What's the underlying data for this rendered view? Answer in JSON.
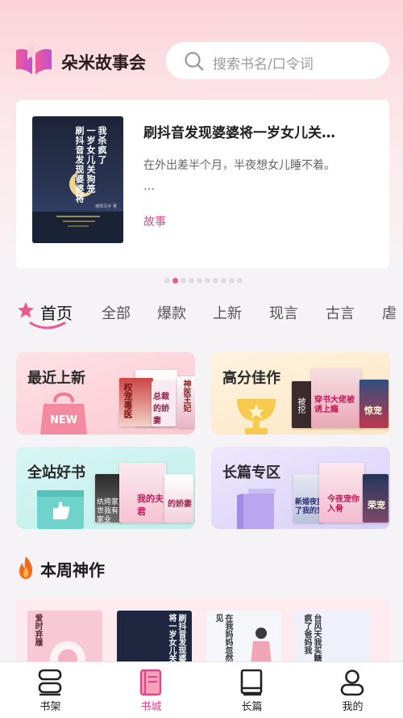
{
  "app": {
    "title": "朵米故事会"
  },
  "search": {
    "placeholder": "搜索书名/口令词"
  },
  "banner": {
    "title": "刷抖音发现婆婆将一岁女儿关…",
    "desc_line1": "在外出差半个月，半夜想女儿睡不着。",
    "desc_line2": "…",
    "tag": "故事",
    "cover_cols": [
      "刷抖音发现婆婆将",
      "一岁女儿关狗笼",
      "我杀疯了"
    ],
    "cover_author": "暖阳写手 著",
    "dot_count": 10,
    "active_dot": 1
  },
  "tabs": [
    "首页",
    "全部",
    "爆款",
    "上新",
    "现言",
    "古言",
    "虐"
  ],
  "cards": [
    {
      "title": "最近上新",
      "badge": "NEW",
      "color": "#fcd3d9"
    },
    {
      "title": "高分佳作",
      "color": "#fde9c8"
    },
    {
      "title": "全站好书",
      "color": "#c9f1ef"
    },
    {
      "title": "长篇专区",
      "color": "#e2dbf8"
    }
  ],
  "card_cover_texts": {
    "recent": [
      "权宠毒医",
      "总裁的娇妻",
      "神医王妃"
    ],
    "high": [
      "被挖",
      "穿书大佬被诱上瘾",
      "惊宠"
    ],
    "good": [
      "纨绔家世我有家业",
      "我的夫君",
      "的娇妻"
    ],
    "long": [
      "新婚夜拔了我的爱",
      "今夜宠你入骨",
      "荣宠"
    ]
  },
  "section": {
    "title": "本周神作"
  },
  "week_covers": [
    {
      "text": "爱时弃履",
      "bg": "#f7c9d6",
      "color": "#5a2a3a"
    },
    {
      "text": "刷抖音发现婆婆将一岁女儿关",
      "bg": "#1f2740",
      "color": "#ffffff"
    },
    {
      "text": "在我妈妈忽然不见",
      "bg": "#f4f6fa",
      "color": "#333333"
    },
    {
      "text": "台风天我买糖们疯了爸妈我",
      "bg": "#eef1fa",
      "color": "#333333"
    }
  ],
  "nav": [
    {
      "label": "书架",
      "icon": "bookshelf-icon",
      "active": false
    },
    {
      "label": "书城",
      "icon": "bookstore-icon",
      "active": true
    },
    {
      "label": "长篇",
      "icon": "book-icon",
      "active": false
    },
    {
      "label": "我的",
      "icon": "profile-icon",
      "active": false
    }
  ],
  "colors": {
    "accent": "#e0448c",
    "brand": "#e95a8f"
  }
}
